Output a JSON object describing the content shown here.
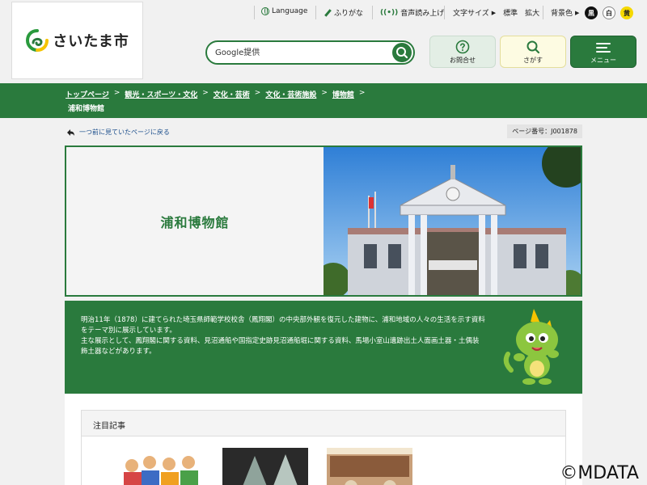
{
  "utility": {
    "language": "Language",
    "furigana": "ふりがな",
    "voice": "音声読み上げ",
    "font_size_label": "文字サイズ",
    "font_standard": "標準",
    "font_large": "拡大",
    "bg_color_label": "背景色",
    "bg_black": "黒",
    "bg_white": "白",
    "bg_yellow": "黄"
  },
  "header": {
    "logo_text": "さいたま市",
    "search_placeholder": "Google提供",
    "ask_label": "お問合せ",
    "search_label": "さがす",
    "menu_label": "メニュー"
  },
  "breadcrumb": {
    "items": [
      "トップページ",
      "観光・スポーツ・文化",
      "文化・芸術",
      "文化・芸術施設",
      "博物館"
    ],
    "current": "浦和博物館"
  },
  "main": {
    "back_link": "一つ前に見ていたページに戻る",
    "page_number": "ページ番号：J001878",
    "title": "浦和博物館",
    "desc_p1": "明治11年（1878）に建てられた埼玉県師範学校校舎（鳳翔閣）の中央部外観を復元した建物に、浦和地域の人々の生活を示す資料をテーマ別に展示しています。",
    "desc_p2": "主な展示として、鳳翔閣に関する資料、見沼通船や国指定史跡見沼通船堀に関する資料、馬場小室山遺跡出土人面画土器・土偶装飾土器などがあります。",
    "featured_title": "注目記事",
    "copyright": "©MDATA"
  },
  "colors": {
    "brand_green": "#2a7a3d",
    "accent_yellow": "#f5d800"
  }
}
